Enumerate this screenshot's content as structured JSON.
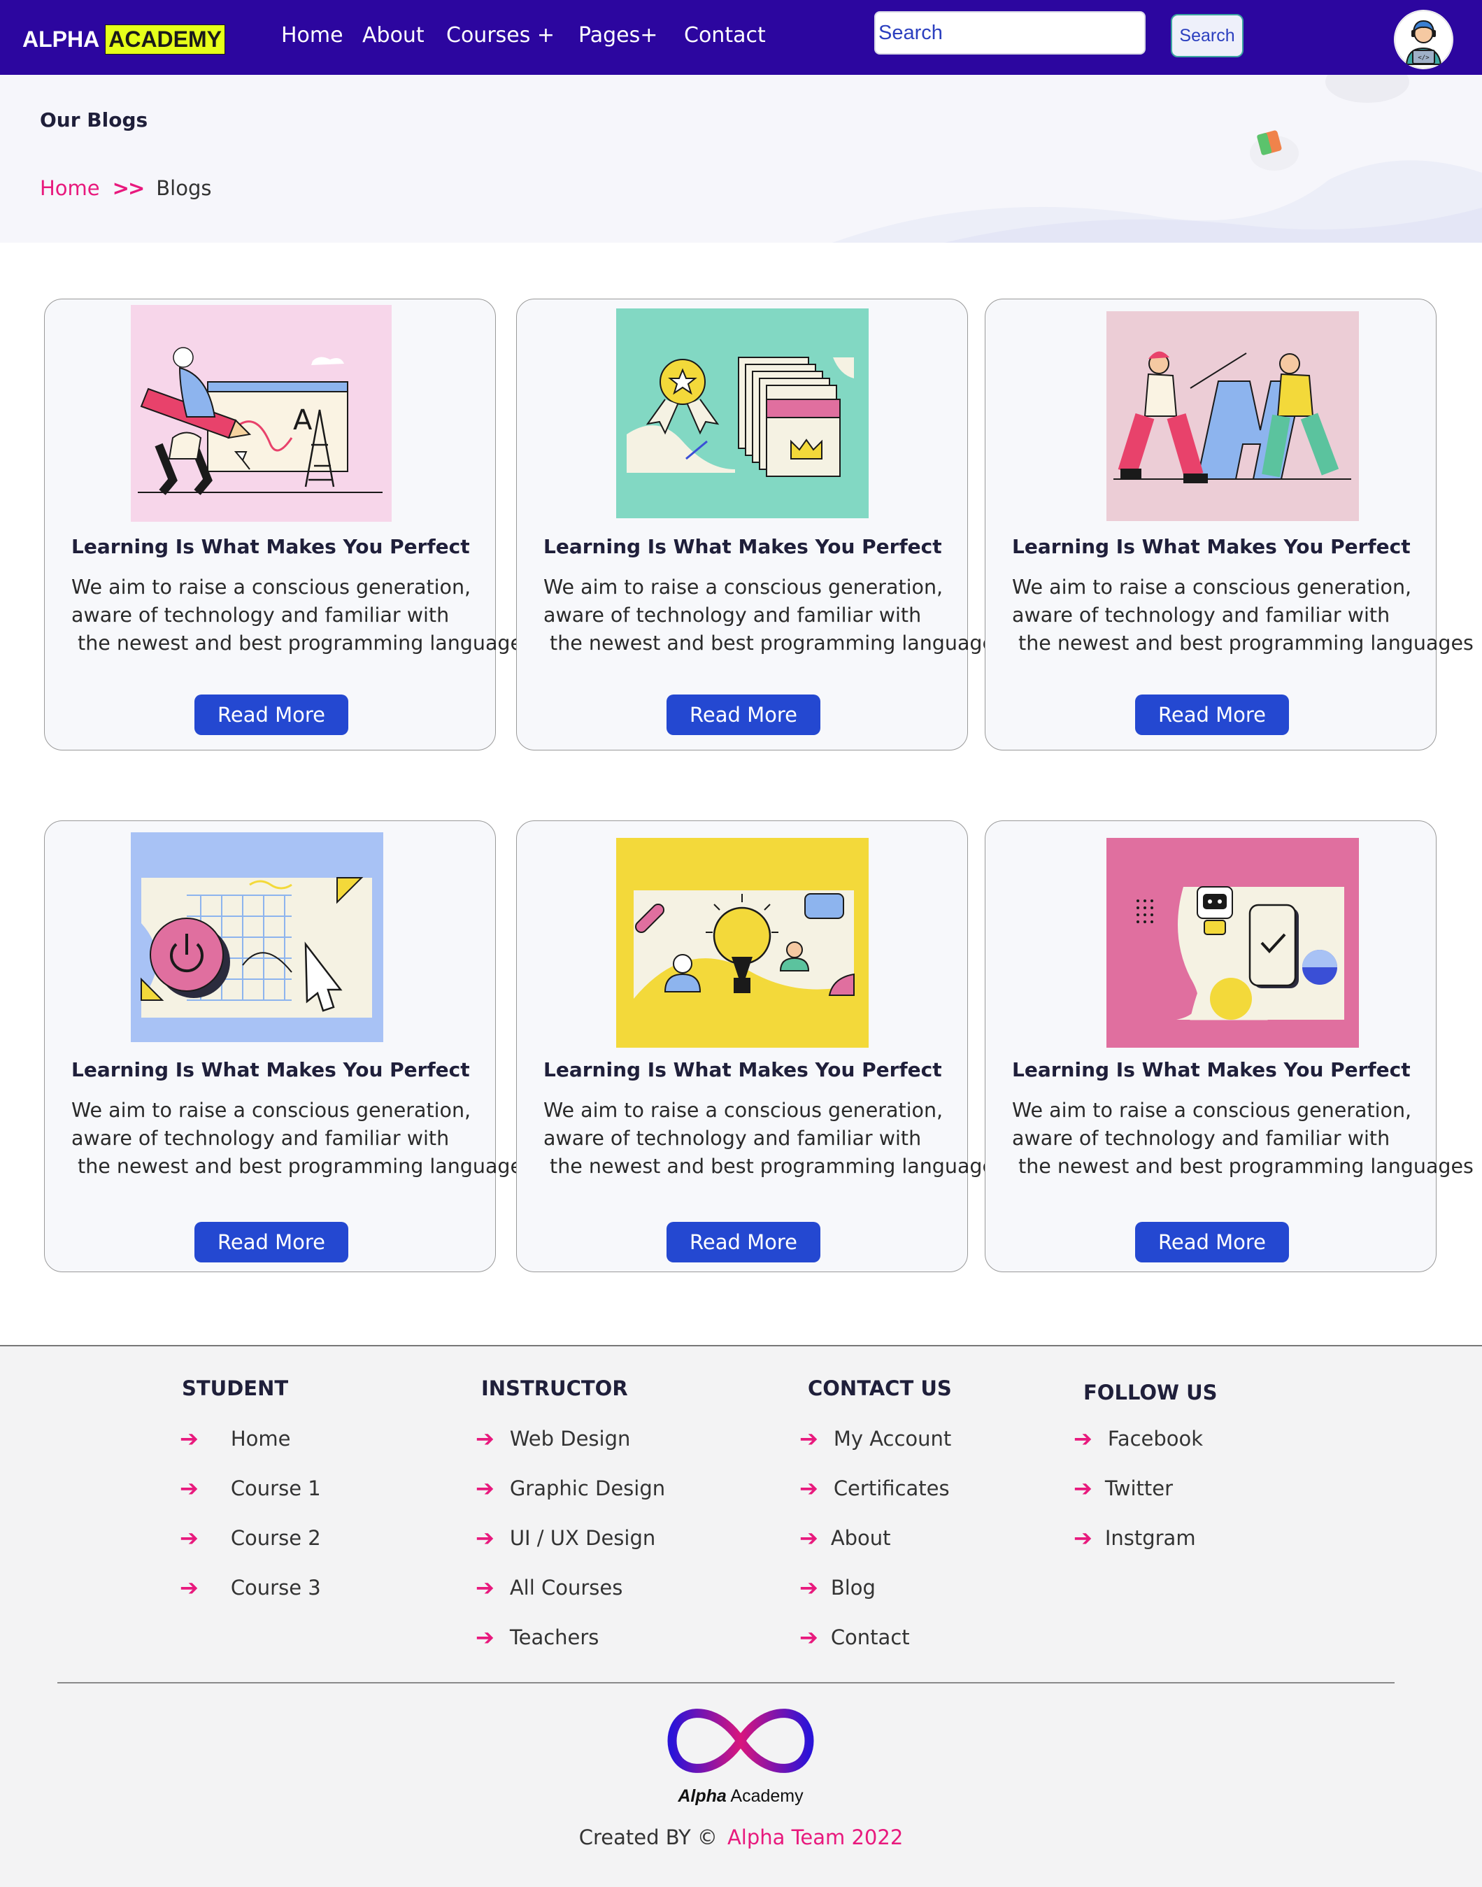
{
  "header": {
    "brand_part1": "ALPHA",
    "brand_part2": "ACADEMY",
    "nav": [
      "Home",
      "About",
      "Courses +",
      "Pages+",
      "Contact"
    ],
    "search_placeholder": "Search",
    "search_button": "Search"
  },
  "hero": {
    "title": "Our Blogs",
    "breadcrumb_home": "Home",
    "breadcrumb_sep": ">>",
    "breadcrumb_current": "Blogs"
  },
  "cards": [
    {
      "title": "Learning Is What Makes You Perfect",
      "text": "We aim to raise a conscious generation,\naware of technology and familiar with\n the newest and best programming languages",
      "button": "Read More",
      "image": "drawing-illustration",
      "bg": "#f7d6ea"
    },
    {
      "title": "Learning Is What Makes You Perfect",
      "text": "We aim to raise a conscious generation,\naware of technology and familiar with\n the newest and best programming languages",
      "button": "Read More",
      "image": "certificate-illustration",
      "bg": "#82d8c3"
    },
    {
      "title": "Learning Is What Makes You Perfect",
      "text": "We aim to raise a conscious generation,\naware of technology and familiar with\n the newest and best programming languages",
      "button": "Read More",
      "image": "people-letter-illustration",
      "bg": "#eccdd6"
    },
    {
      "title": "Learning Is What Makes You Perfect",
      "text": "We aim to raise a conscious generation,\naware of technology and familiar with\n the newest and best programming languages",
      "button": "Read More",
      "image": "power-cursor-illustration",
      "bg": "#a8c2f5"
    },
    {
      "title": "Learning Is What Makes You Perfect",
      "text": "We aim to raise a conscious generation,\naware of technology and familiar with\n the newest and best programming languages",
      "button": "Read More",
      "image": "lightbulb-idea-illustration",
      "bg": "#f3d93a"
    },
    {
      "title": "Learning Is What Makes You Perfect",
      "text": "We aim to raise a conscious generation,\naware of technology and familiar with\n the newest and best programming languages",
      "button": "Read More",
      "image": "phone-robot-illustration",
      "bg": "#e06f9f"
    }
  ],
  "footer": {
    "student": {
      "heading": "STUDENT",
      "items": [
        "Home",
        "Course 1",
        "Course 2",
        "Course 3"
      ]
    },
    "instructor": {
      "heading": "INSTRUCTOR",
      "items": [
        "Web Design",
        "Graphic Design",
        "UI / UX Design",
        "All Courses",
        "Teachers"
      ]
    },
    "contact": {
      "heading": "CONTACT US",
      "items": [
        "My Account",
        "Certificates",
        "About",
        "Blog",
        "Contact"
      ]
    },
    "follow": {
      "heading": "FOLLOW US",
      "items": [
        "Facebook",
        "Twitter",
        "Instgram"
      ]
    },
    "logo_word1": "Alpha",
    "logo_word2": "Academy",
    "credit_prefix": "Created BY ©",
    "credit_team": "Alpha Team 2022"
  },
  "colors": {
    "nav_bg": "#2c069f",
    "brand_highlight": "#e6ff1a",
    "accent_pink": "#e8197d",
    "button_blue": "#2448d1",
    "footer_bg": "#f3f3f4"
  },
  "icons": [
    "avatar-icon",
    "arrow-right-icon",
    "infinity-logo-icon"
  ]
}
